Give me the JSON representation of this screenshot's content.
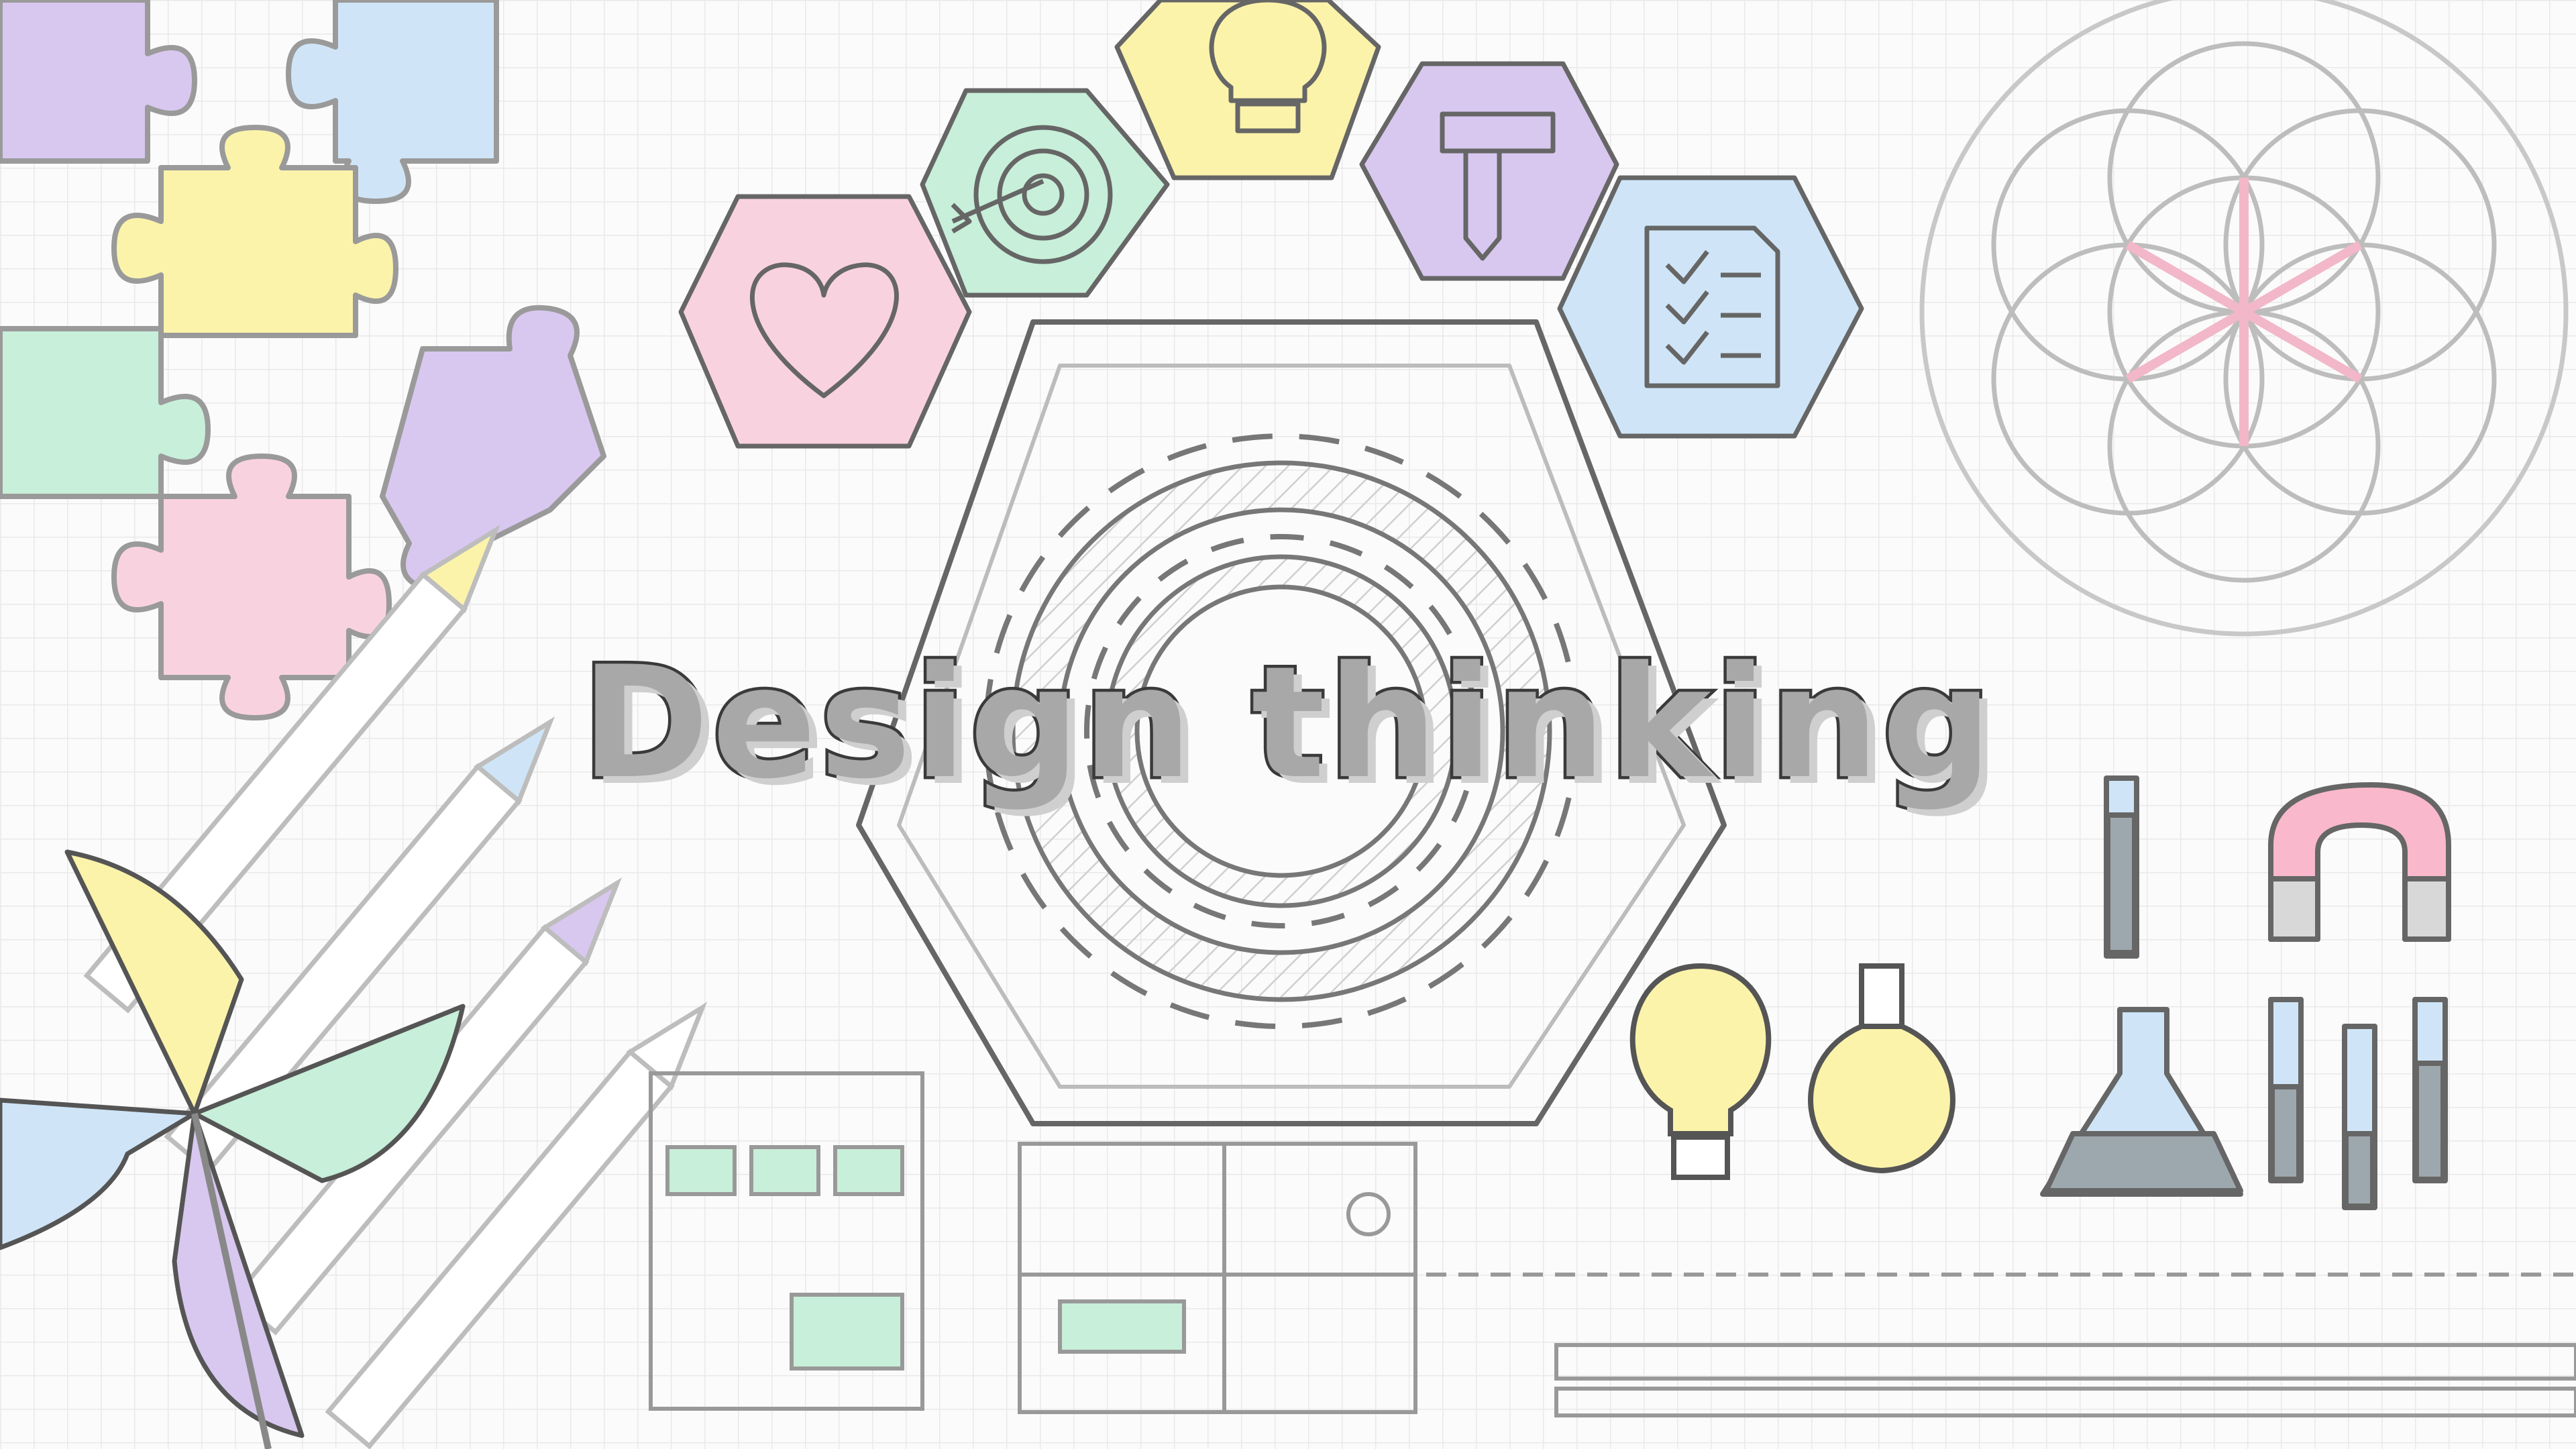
{
  "title": "Design thinking",
  "colors": {
    "pink": "#f9d2e0",
    "yellow": "#fbf3aa",
    "mint": "#c8efd9",
    "lavender": "#d8c8ef",
    "blue": "#cfe5f7",
    "line": "#6a6a6a",
    "grid": "#e8e8e8"
  },
  "icons": [
    "heart-icon",
    "target-icon",
    "lightbulb-icon",
    "hammer-pencil-icon",
    "checklist-icon",
    "gear-icon",
    "flower-of-life-icon",
    "puzzle-icon",
    "pencil-icon",
    "pinwheel-icon",
    "test-tube-icon",
    "magnet-icon",
    "flask-icon",
    "wireframe-icon"
  ]
}
